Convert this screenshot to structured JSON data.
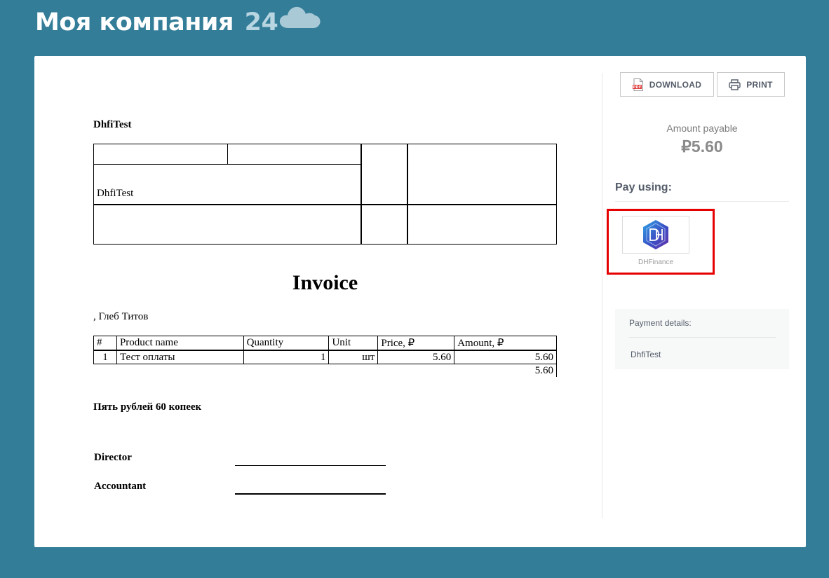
{
  "header": {
    "brand_name": "Моя компания",
    "brand_number": "24"
  },
  "invoice": {
    "company": "DhfiTest",
    "requisites_company": "DhfiTest",
    "title": "Invoice",
    "buyer": ", Глеб Титов",
    "columns": [
      "#",
      "Product name",
      "Quantity",
      "Unit",
      "Price, ₽",
      "Amount, ₽"
    ],
    "rows": [
      {
        "num": "1",
        "name": "Тест оплаты",
        "qty": "1",
        "unit": "шт",
        "price": "5.60",
        "amount": "5.60"
      }
    ],
    "total": "5.60",
    "amount_words": "Пять рублей 60 копеек",
    "director_label": "Director",
    "accountant_label": "Accountant"
  },
  "actions": {
    "download_label": "DOWNLOAD",
    "print_label": "PRINT",
    "pdf_badge": "PDF"
  },
  "payment": {
    "amount_label": "Amount payable",
    "amount_value": "₽5.60",
    "pay_using_label": "Pay using:",
    "systems": [
      {
        "name": "DHFinance",
        "icon": "dhfinance-logo"
      }
    ],
    "details_label": "Payment details:",
    "details_value": "DhfiTest"
  },
  "colors": {
    "background": "#337d98",
    "highlight": "#e60000",
    "pdf_red": "#e03a3a",
    "logo_blue": "#3a4fc4"
  }
}
